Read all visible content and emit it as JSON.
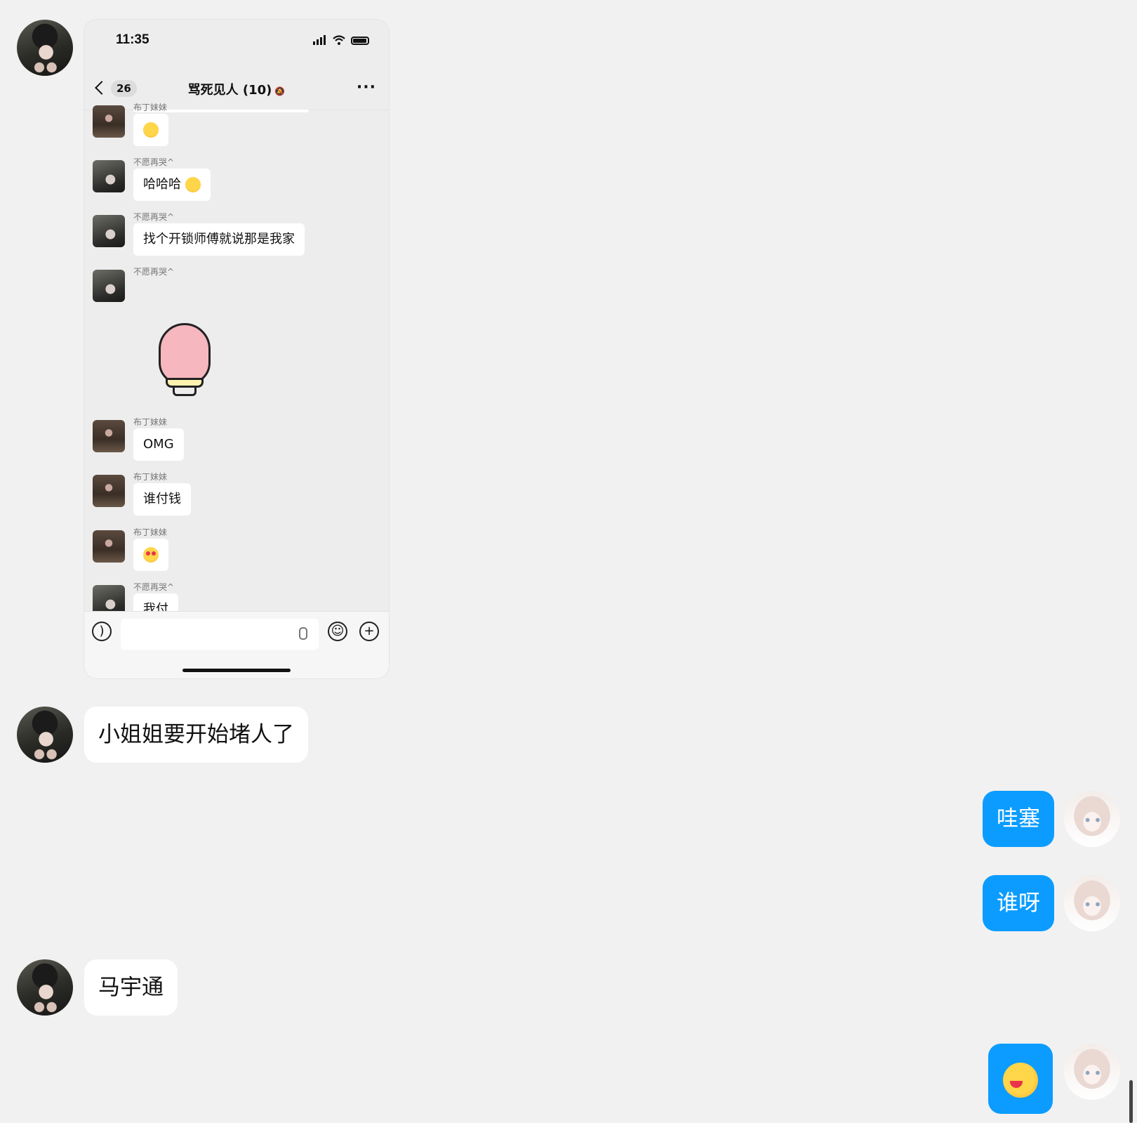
{
  "phone_screenshot": {
    "status_time": "11:35",
    "unread_count": "26",
    "chat_title": "骂死见人 (10)",
    "messages": [
      {
        "sender": "布丁妹妹",
        "text": ""
      },
      {
        "sender": "不愿再哭^",
        "text": "哈哈哈"
      },
      {
        "sender": "不愿再哭^",
        "text": "找个开锁师傅就说那是我家"
      },
      {
        "sender": "不愿再哭^",
        "text": ""
      },
      {
        "sender": "布丁妹妹",
        "text": "OMG"
      },
      {
        "sender": "布丁妹妹",
        "text": "谁付钱"
      },
      {
        "sender": "布丁妹妹",
        "text": ""
      },
      {
        "sender": "不愿再哭^",
        "text": "我付"
      }
    ]
  },
  "chat": [
    {
      "side": "left",
      "text": "小姐姐要开始堵人了"
    },
    {
      "side": "right",
      "text": "哇塞"
    },
    {
      "side": "right",
      "text": "谁呀"
    },
    {
      "side": "left",
      "text": "马宇通"
    },
    {
      "side": "right",
      "text": ""
    }
  ],
  "colors": {
    "background": "#f1f1f1",
    "outgoing_bubble": "#0c9cff",
    "incoming_bubble": "#ffffff"
  },
  "icons": [
    "back-icon",
    "more-icon",
    "mute-icon",
    "voice-icon",
    "mic-icon",
    "emoji-icon",
    "plus-icon"
  ]
}
